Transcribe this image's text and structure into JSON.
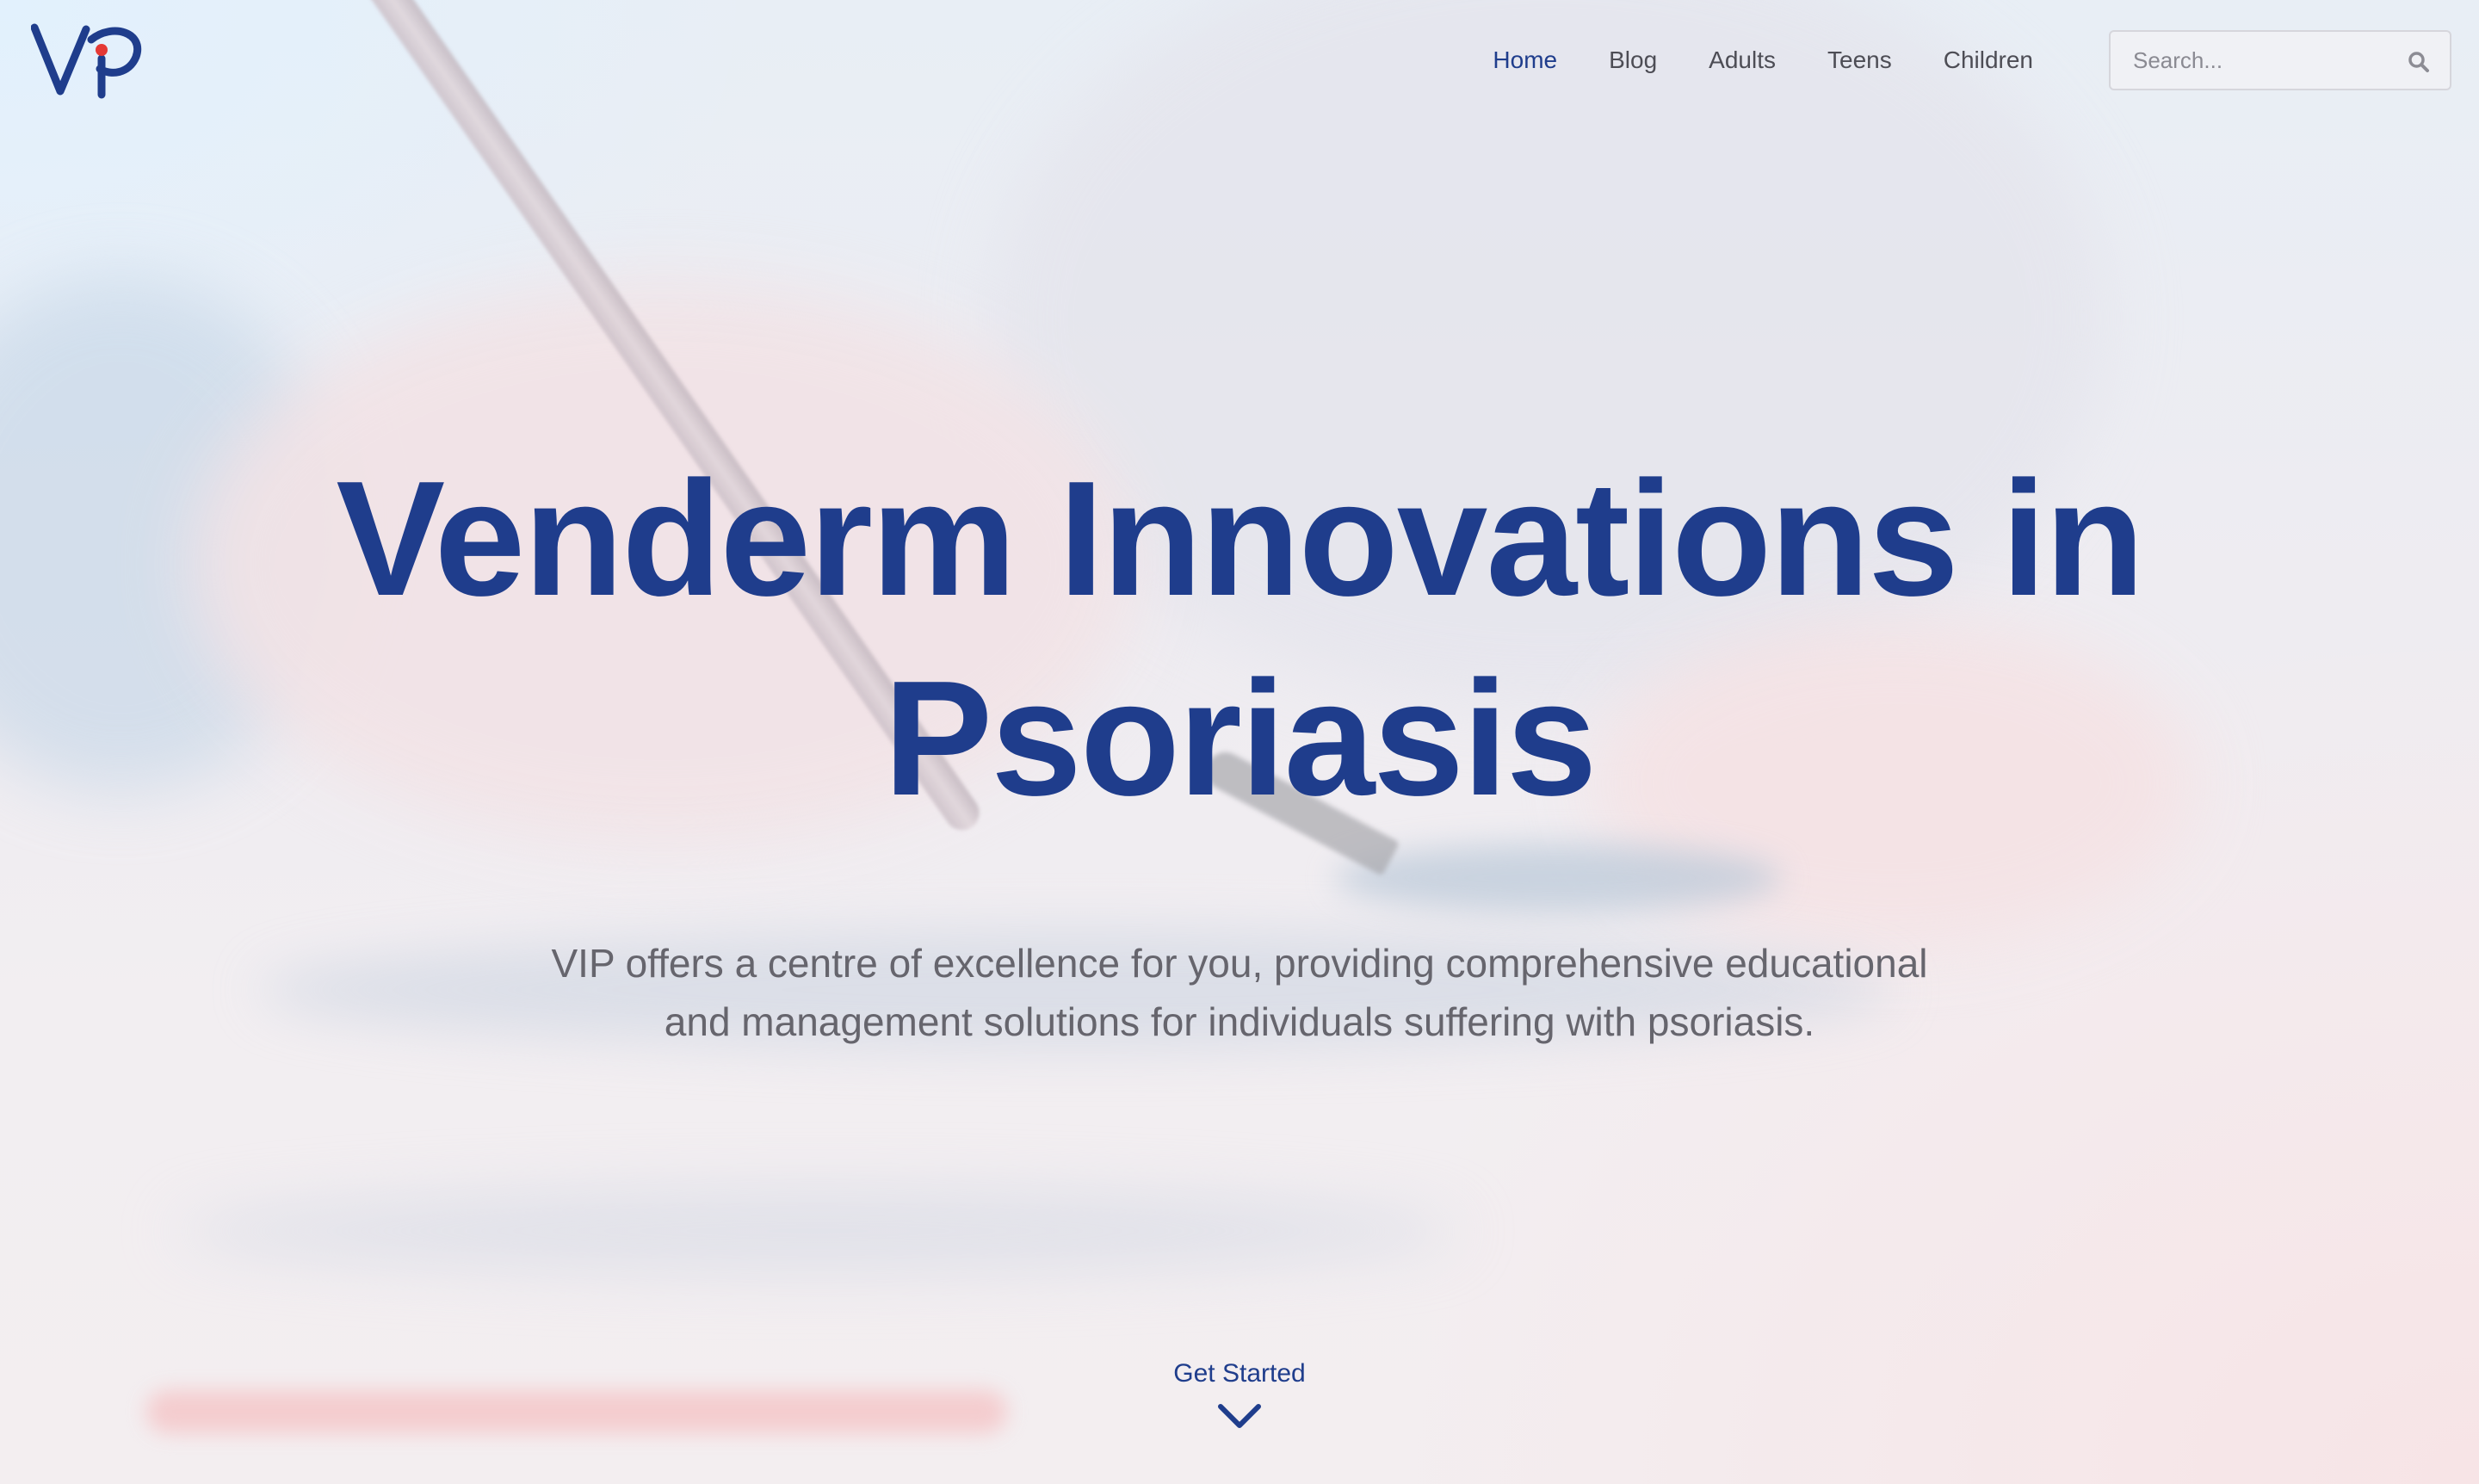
{
  "brand": {
    "logo_text": "VIP",
    "primary_color": "#1f3d8c",
    "accent_color": "#e53935"
  },
  "nav": {
    "items": [
      {
        "label": "Home",
        "active": true
      },
      {
        "label": "Blog",
        "active": false
      },
      {
        "label": "Adults",
        "active": false
      },
      {
        "label": "Teens",
        "active": false
      },
      {
        "label": "Children",
        "active": false
      }
    ]
  },
  "search": {
    "placeholder": "Search...",
    "icon": "search-icon"
  },
  "hero": {
    "title_line1": "Venderm Innovations in",
    "title_line2": "Psoriasis",
    "subtitle_line1": "VIP offers a centre of excellence for you, providing comprehensive educational",
    "subtitle_line2": "and management solutions for individuals suffering with psoriasis."
  },
  "cta": {
    "label": "Get Started",
    "icon": "chevron-down-icon"
  }
}
